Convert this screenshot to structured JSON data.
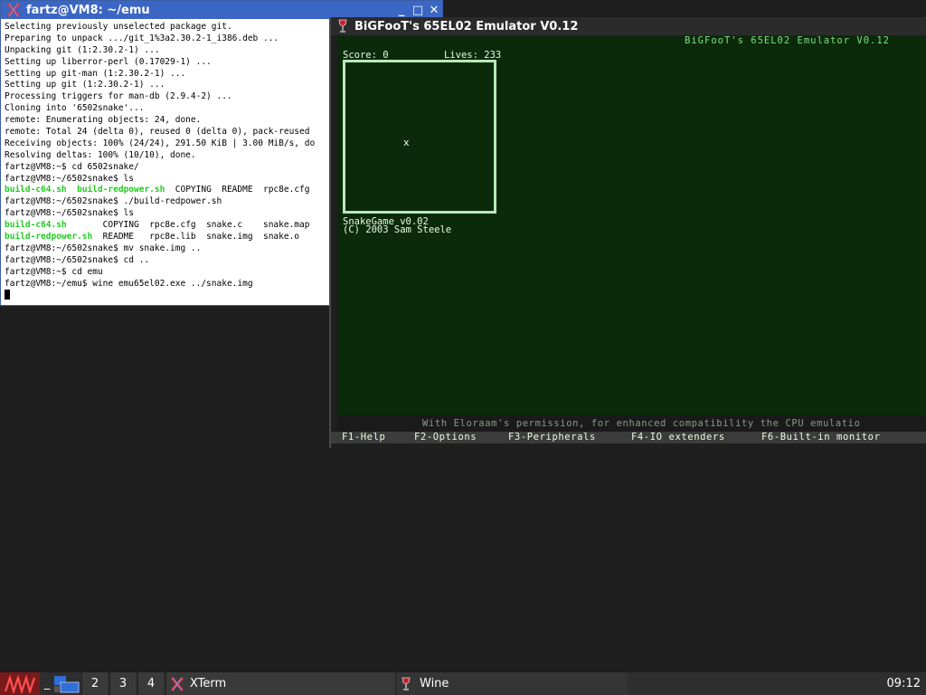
{
  "xterm": {
    "title": "fartz@VM8: ~/emu",
    "minimize": "_",
    "maximize": "□",
    "close": "✕",
    "lines": [
      [
        {
          "t": "Selecting previously unselected package git."
        }
      ],
      [
        {
          "t": "Preparing to unpack .../git_1%3a2.30.2-1_i386.deb ..."
        }
      ],
      [
        {
          "t": "Unpacking git (1:2.30.2-1) ..."
        }
      ],
      [
        {
          "t": "Setting up liberror-perl (0.17029-1) ..."
        }
      ],
      [
        {
          "t": "Setting up git-man (1:2.30.2-1) ..."
        }
      ],
      [
        {
          "t": "Setting up git (1:2.30.2-1) ..."
        }
      ],
      [
        {
          "t": "Processing triggers for man-db (2.9.4-2) ..."
        }
      ],
      [
        {
          "t": "Cloning into '6502snake'..."
        }
      ],
      [
        {
          "t": "remote: Enumerating objects: 24, done."
        }
      ],
      [
        {
          "t": "remote: Total 24 (delta 0), reused 0 (delta 0), pack-reused"
        }
      ],
      [
        {
          "t": "Receiving objects: 100% (24/24), 291.50 KiB | 3.00 MiB/s, do"
        }
      ],
      [
        {
          "t": "Resolving deltas: 100% (10/10), done."
        }
      ],
      [
        {
          "t": "fartz@VM8:~$ cd 6502snake/"
        }
      ],
      [
        {
          "t": "fartz@VM8:~/6502snake$ ls"
        }
      ],
      [
        {
          "t": "build-c64.sh",
          "c": "g"
        },
        {
          "t": "  "
        },
        {
          "t": "build-redpower.sh",
          "c": "g"
        },
        {
          "t": "  COPYING  README  rpc8e.cfg"
        }
      ],
      [
        {
          "t": "fartz@VM8:~/6502snake$ ./build-redpower.sh"
        }
      ],
      [
        {
          "t": "fartz@VM8:~/6502snake$ ls"
        }
      ],
      [
        {
          "t": "build-c64.sh",
          "c": "g"
        },
        {
          "t": "       COPYING  rpc8e.cfg  snake.c    snake.map"
        }
      ],
      [
        {
          "t": "build-redpower.sh",
          "c": "g"
        },
        {
          "t": "  README   rpc8e.lib  snake.img  snake.o"
        }
      ],
      [
        {
          "t": "fartz@VM8:~/6502snake$ mv snake.img .."
        }
      ],
      [
        {
          "t": "fartz@VM8:~/6502snake$ cd .."
        }
      ],
      [
        {
          "t": "fartz@VM8:~$ cd emu"
        }
      ],
      [
        {
          "t": "fartz@VM8:~/emu$ wine emu65el02.exe ../snake.img"
        }
      ]
    ]
  },
  "wine_window": {
    "title": "BiGFooT's 65EL02 Emulator V0.12",
    "screen": {
      "header_title": "BiGFooT's 65EL02 Emulator V0.12",
      "score_label": "Score: 0",
      "lives_label": "Lives: 233",
      "food_char": "x",
      "game_name": "SnakeGame v0.02",
      "copyright": "(C) 2003 Sam Steele",
      "marquee": "With Eloraam's permission, for enhanced compatibility the CPU emulatio"
    },
    "function_keys": [
      {
        "label": "F1-Help"
      },
      {
        "label": "F2-Options"
      },
      {
        "label": "F3-Peripherals"
      },
      {
        "label": "F4-IO extenders"
      },
      {
        "label": "F6-Built-in monitor"
      }
    ]
  },
  "taskbar": {
    "workspaces": [
      "2",
      "3",
      "4"
    ],
    "tasks": [
      {
        "label": "XTerm"
      },
      {
        "label": "Wine"
      }
    ],
    "clock": "09:12"
  },
  "colors": {
    "xterm_titlebar": "#3b66c4",
    "terminal_green": "#22cc22",
    "emu_background": "#0a2a0a",
    "emu_header": "#7fe07f",
    "taskbar": "#2e2e2e"
  }
}
